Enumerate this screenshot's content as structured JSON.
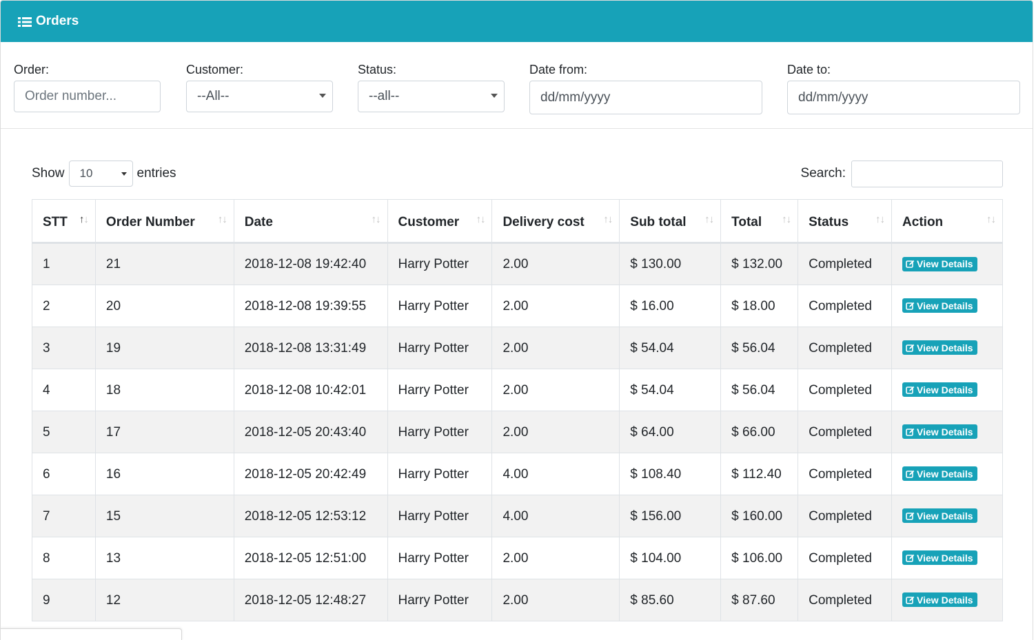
{
  "header": {
    "title": "Orders",
    "icon": "list-icon"
  },
  "filters": {
    "order": {
      "label": "Order:",
      "placeholder": "Order number..."
    },
    "customer": {
      "label": "Customer:",
      "value": "--All--"
    },
    "status": {
      "label": "Status:",
      "value": "--all--"
    },
    "date_from": {
      "label": "Date from:",
      "placeholder": "dd/mm/yyyy"
    },
    "date_to": {
      "label": "Date to:",
      "placeholder": "dd/mm/yyyy"
    }
  },
  "table_controls": {
    "show_label": "Show",
    "entries_value": "10",
    "entries_label": "entries",
    "search_label": "Search:"
  },
  "table": {
    "columns": [
      "STT",
      "Order Number",
      "Date",
      "Customer",
      "Delivery cost",
      "Sub total",
      "Total",
      "Status",
      "Action"
    ],
    "action_label": "View Details",
    "rows": [
      {
        "stt": "1",
        "order": "21",
        "date": "2018-12-08 19:42:40",
        "customer": "Harry Potter",
        "delivery": "2.00",
        "subtotal": "$ 130.00",
        "total": "$ 132.00",
        "status": "Completed"
      },
      {
        "stt": "2",
        "order": "20",
        "date": "2018-12-08 19:39:55",
        "customer": "Harry Potter",
        "delivery": "2.00",
        "subtotal": "$ 16.00",
        "total": "$ 18.00",
        "status": "Completed"
      },
      {
        "stt": "3",
        "order": "19",
        "date": "2018-12-08 13:31:49",
        "customer": "Harry Potter",
        "delivery": "2.00",
        "subtotal": "$ 54.04",
        "total": "$ 56.04",
        "status": "Completed"
      },
      {
        "stt": "4",
        "order": "18",
        "date": "2018-12-08 10:42:01",
        "customer": "Harry Potter",
        "delivery": "2.00",
        "subtotal": "$ 54.04",
        "total": "$ 56.04",
        "status": "Completed"
      },
      {
        "stt": "5",
        "order": "17",
        "date": "2018-12-05 20:43:40",
        "customer": "Harry Potter",
        "delivery": "2.00",
        "subtotal": "$ 64.00",
        "total": "$ 66.00",
        "status": "Completed"
      },
      {
        "stt": "6",
        "order": "16",
        "date": "2018-12-05 20:42:49",
        "customer": "Harry Potter",
        "delivery": "4.00",
        "subtotal": "$ 108.40",
        "total": "$ 112.40",
        "status": "Completed"
      },
      {
        "stt": "7",
        "order": "15",
        "date": "2018-12-05 12:53:12",
        "customer": "Harry Potter",
        "delivery": "4.00",
        "subtotal": "$ 156.00",
        "total": "$ 160.00",
        "status": "Completed"
      },
      {
        "stt": "8",
        "order": "13",
        "date": "2018-12-05 12:51:00",
        "customer": "Harry Potter",
        "delivery": "2.00",
        "subtotal": "$ 104.00",
        "total": "$ 106.00",
        "status": "Completed"
      },
      {
        "stt": "9",
        "order": "12",
        "date": "2018-12-05 12:48:27",
        "customer": "Harry Potter",
        "delivery": "2.00",
        "subtotal": "$ 85.60",
        "total": "$ 87.60",
        "status": "Completed"
      }
    ]
  },
  "colors": {
    "accent": "#17a2b8",
    "stripe": "#f2f2f2",
    "border": "#dee2e6"
  }
}
